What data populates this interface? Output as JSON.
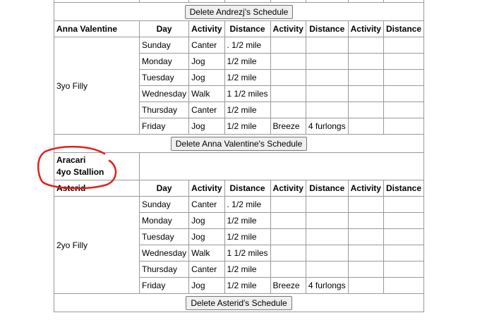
{
  "delete_andrezj": "Delete Andrezj's Schedule",
  "headers": [
    "Day",
    "Activity",
    "Distance",
    "Activity",
    "Distance",
    "Activity",
    "Distance"
  ],
  "horses": [
    {
      "name": "Anna Valentine",
      "desc": "3yo Filly",
      "rows": [
        [
          "Sunday",
          "Canter",
          ". 1/2 mile",
          "",
          "",
          "",
          ""
        ],
        [
          "Monday",
          "Jog",
          "1/2 mile",
          "",
          "",
          "",
          ""
        ],
        [
          "Tuesday",
          "Jog",
          "1/2 mile",
          "",
          "",
          "",
          ""
        ],
        [
          "Wednesday",
          "Walk",
          "1 1/2 miles",
          "",
          "",
          "",
          ""
        ],
        [
          "Thursday",
          "Canter",
          "1/2 mile",
          "",
          "",
          "",
          ""
        ],
        [
          "Friday",
          "Jog",
          "1/2 mile",
          "Breeze",
          "4 furlongs",
          "",
          ""
        ]
      ],
      "delete_label": "Delete Anna Valentine's Schedule"
    },
    {
      "name": "Asterid",
      "desc": "2yo Filly",
      "rows": [
        [
          "Sunday",
          "Canter",
          ". 1/2 mile",
          "",
          "",
          "",
          ""
        ],
        [
          "Monday",
          "Jog",
          "1/2 mile",
          "",
          "",
          "",
          ""
        ],
        [
          "Tuesday",
          "Jog",
          "1/2 mile",
          "",
          "",
          "",
          ""
        ],
        [
          "Wednesday",
          "Walk",
          "1 1/2 miles",
          "",
          "",
          "",
          ""
        ],
        [
          "Thursday",
          "Canter",
          "1/2 mile",
          "",
          "",
          "",
          ""
        ],
        [
          "Friday",
          "Jog",
          "1/2 mile",
          "Breeze",
          "4 furlongs",
          "",
          ""
        ]
      ],
      "delete_label": "Delete Asterid's Schedule"
    }
  ],
  "aracari": {
    "name": "Aracari",
    "desc": "4yo Stallion"
  },
  "annotation_color": "#e0201b"
}
